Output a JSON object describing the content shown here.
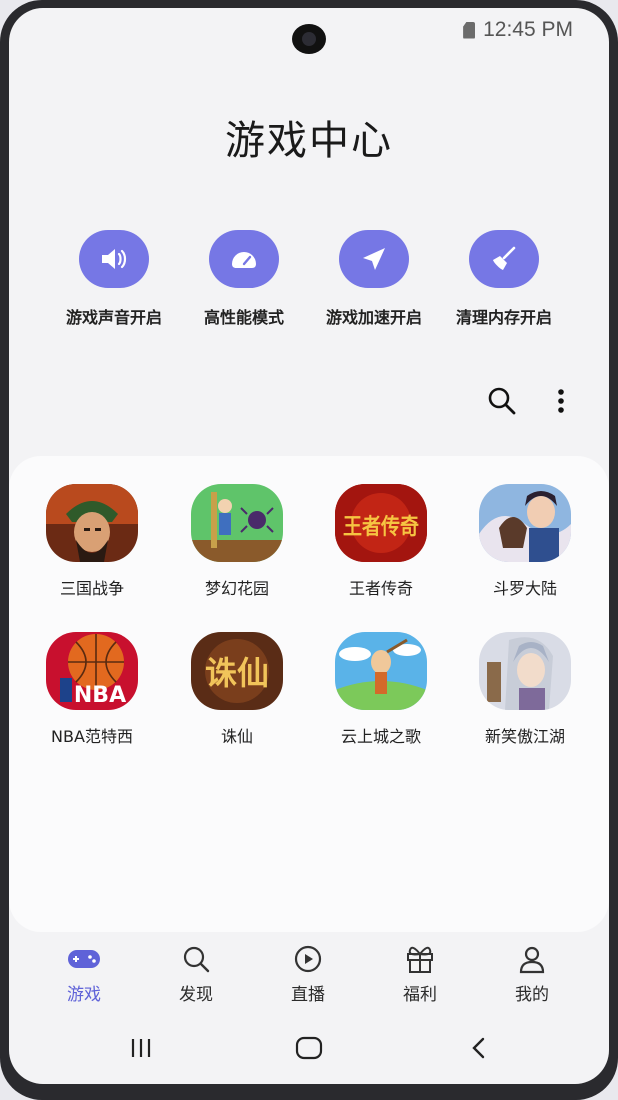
{
  "status_bar": {
    "time": "12:45 PM",
    "icons": [
      "sim-icon"
    ]
  },
  "header": {
    "title": "游戏中心"
  },
  "quick_actions": [
    {
      "label": "游戏声音开启",
      "icon": "speaker-icon"
    },
    {
      "label": "高性能模式",
      "icon": "speedometer-icon"
    },
    {
      "label": "游戏加速开启",
      "icon": "paper-plane-icon"
    },
    {
      "label": "清理内存开启",
      "icon": "broom-icon"
    }
  ],
  "toolbar": {
    "icons": [
      "search-icon",
      "more-icon"
    ]
  },
  "games": [
    {
      "name": "三国战争",
      "icon": "game-sanguo-icon"
    },
    {
      "name": "梦幻花园",
      "icon": "game-garden-icon"
    },
    {
      "name": "王者传奇",
      "icon": "game-legend-icon"
    },
    {
      "name": "斗罗大陆",
      "icon": "game-douluo-icon"
    },
    {
      "name": "NBA范特西",
      "icon": "game-nba-icon"
    },
    {
      "name": "诛仙",
      "icon": "game-zhuxian-icon"
    },
    {
      "name": "云上城之歌",
      "icon": "game-cloudcity-icon"
    },
    {
      "name": "新笑傲江湖",
      "icon": "game-jianghu-icon"
    }
  ],
  "game_icon_text": {
    "legend": "王者传奇",
    "nba": "NBA",
    "zhuxian": "诛仙"
  },
  "bottom_nav": [
    {
      "label": "游戏",
      "icon": "gamepad-icon",
      "active": true
    },
    {
      "label": "发现",
      "icon": "search-icon",
      "active": false
    },
    {
      "label": "直播",
      "icon": "play-circle-icon",
      "active": false
    },
    {
      "label": "福利",
      "icon": "gift-icon",
      "active": false
    },
    {
      "label": "我的",
      "icon": "person-icon",
      "active": false
    }
  ],
  "system_nav": {
    "icons": [
      "recents-icon",
      "home-icon",
      "back-icon"
    ]
  },
  "colors": {
    "accent": "#7677e5",
    "active_nav": "#5f62d8",
    "background": "#f3f3f5",
    "panel": "#fbfbfc"
  }
}
